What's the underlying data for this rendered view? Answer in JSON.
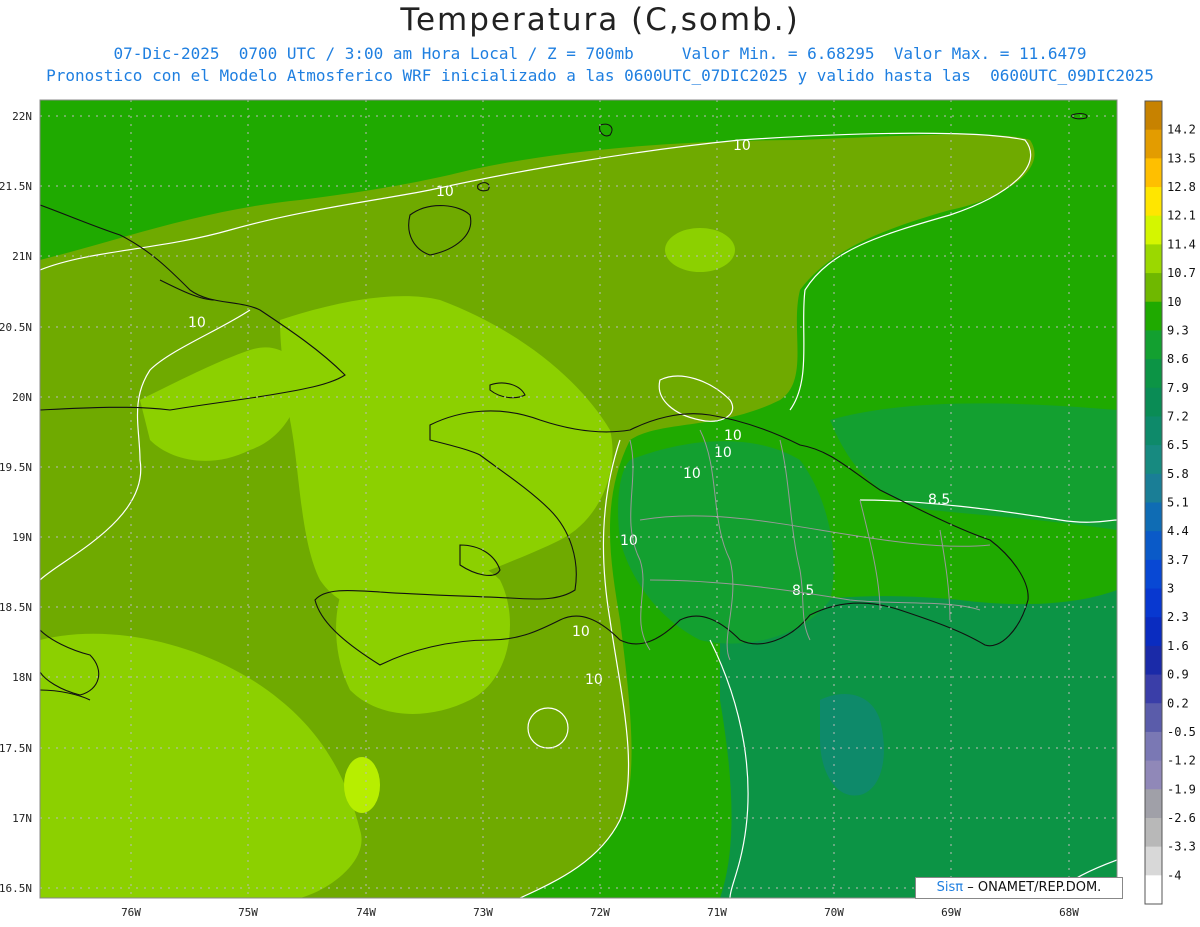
{
  "title": "Temperatura (C,somb.)",
  "subtitle_line1": "07-Dic-2025  0700 UTC / 3:00 am Hora Local / Z = 700mb     Valor Min. = 6.68295  Valor Max. = 11.6479",
  "subtitle_line2": "Pronostico con el Modelo Atmosferico WRF inicializado a las 0600UTC_07DIC2025 y valido hasta las  0600UTC_09DIC2025",
  "lat_ticks": [
    "22N",
    "21.5N",
    "21N",
    "20.5N",
    "20N",
    "19.5N",
    "19N",
    "18.5N",
    "18N",
    "17.5N",
    "17N",
    "16.5N"
  ],
  "lon_ticks": [
    "76W",
    "75W",
    "74W",
    "73W",
    "72W",
    "71W",
    "70W",
    "69W",
    "68W"
  ],
  "colorbar": {
    "labels": [
      "14.2",
      "13.5",
      "12.8",
      "12.1",
      "11.4",
      "10.7",
      "10",
      "9.3",
      "8.6",
      "7.9",
      "7.2",
      "6.5",
      "5.8",
      "5.1",
      "4.4",
      "3.7",
      "3",
      "2.3",
      "1.6",
      "0.9",
      "0.2",
      "-0.5",
      "-1.2",
      "-1.9",
      "-2.6",
      "-3.3",
      "-4"
    ],
    "colors": [
      "#c78200",
      "#e39c00",
      "#ffbf00",
      "#ffe600",
      "#d4f600",
      "#9bd800",
      "#6fb800",
      "#1faa00",
      "#13a030",
      "#0c9445",
      "#0a8c55",
      "#0e8a6a",
      "#178a80",
      "#1a7e96",
      "#0f6cb4",
      "#0a5ac8",
      "#0848d4",
      "#0838d0",
      "#0a2cc0",
      "#1a2aa8",
      "#3a3ea8",
      "#5a5caa",
      "#7a78b4",
      "#9088b8",
      "#a0a0a8",
      "#b8b8b8",
      "#d8d8d8",
      "#ffffff"
    ]
  },
  "contour_labels": [
    "10",
    "10",
    "10",
    "10",
    "10",
    "10",
    "10",
    "10",
    "10",
    "8.5",
    "8.5"
  ],
  "credit": {
    "brand": "Sisπ",
    "text": "– ONAMET/REP.DOM."
  }
}
